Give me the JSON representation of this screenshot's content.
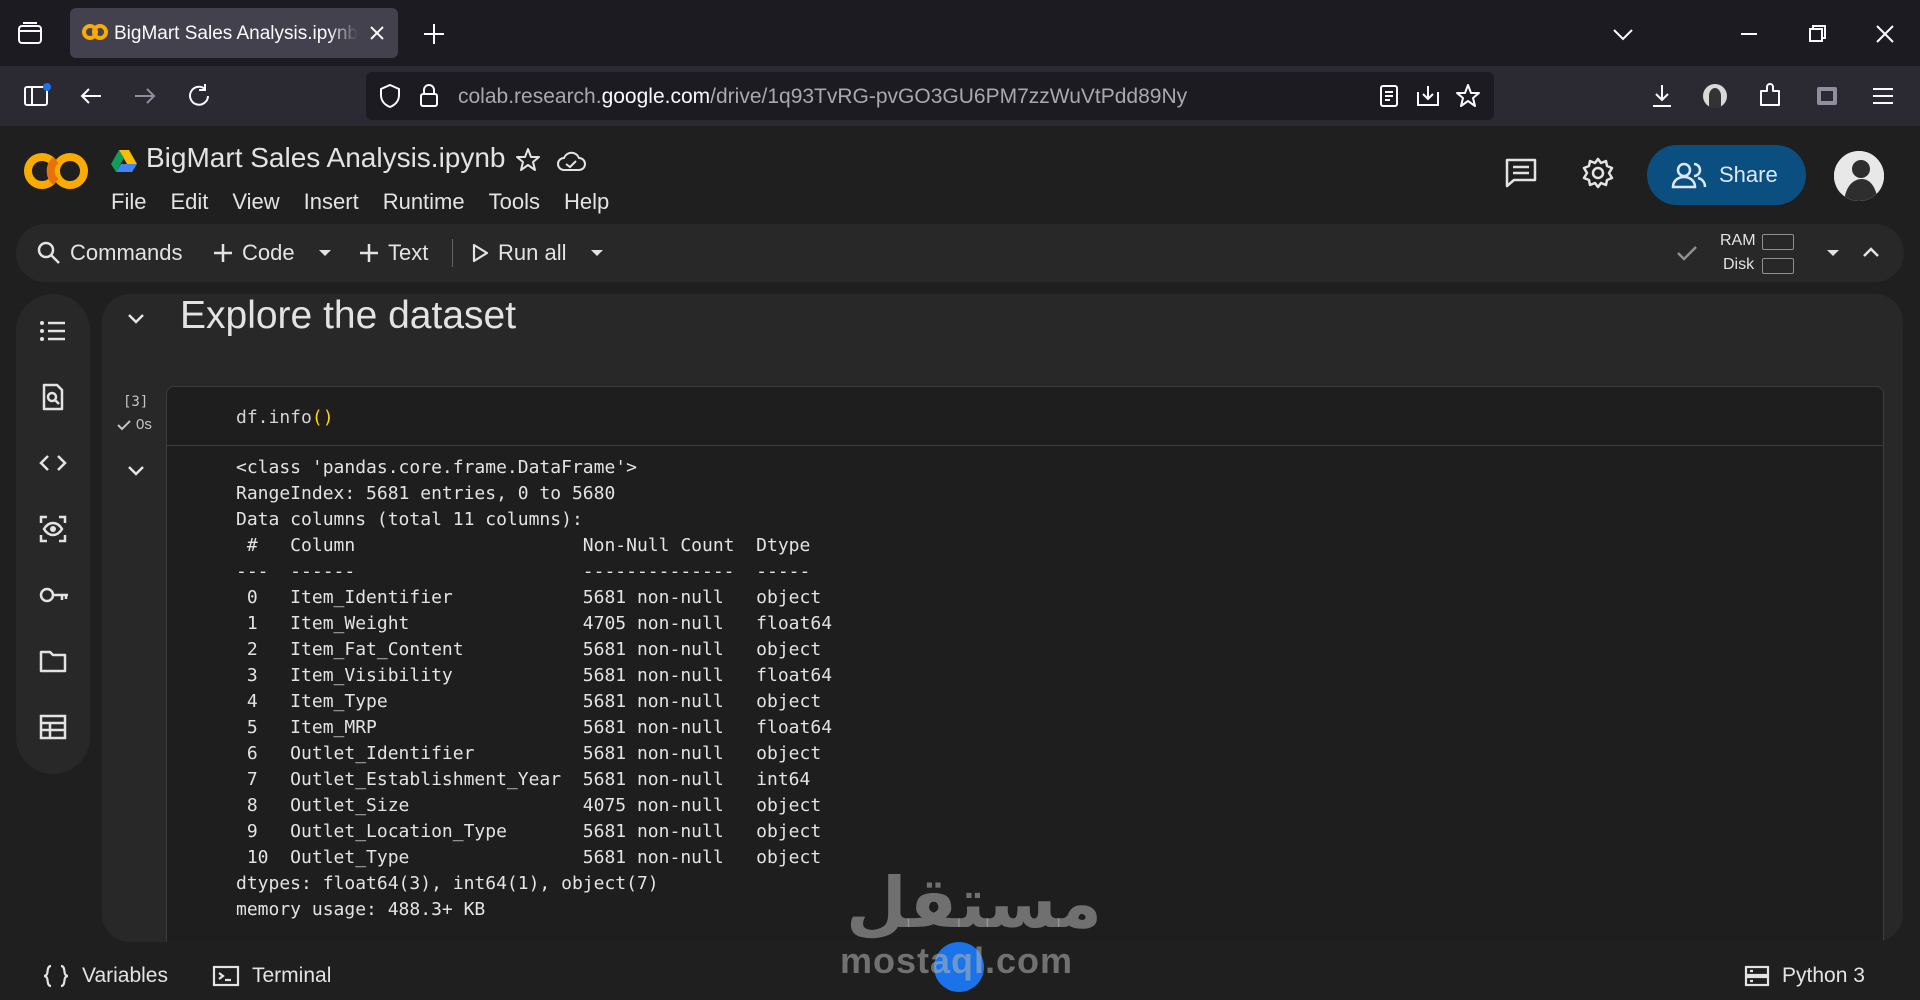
{
  "browser": {
    "tab_title": "BigMart Sales Analysis.ipynb - Colab",
    "url_prefix": "colab.research.",
    "url_host": "google.com",
    "url_path": "/drive/1q93TvRG-pvGO3GU6PM7zzWuVtPdd89Ny"
  },
  "header": {
    "notebook_title": "BigMart Sales Analysis.ipynb",
    "menu": [
      "File",
      "Edit",
      "View",
      "Insert",
      "Runtime",
      "Tools",
      "Help"
    ],
    "share_label": "Share"
  },
  "toolbar": {
    "commands_label": "Commands",
    "code_label": "Code",
    "text_label": "Text",
    "run_all_label": "Run all",
    "ram_label": "RAM",
    "disk_label": "Disk"
  },
  "notebook": {
    "section_title": "Explore the dataset",
    "cell": {
      "exec_count": "[3]",
      "exec_time": "0s",
      "code_prefix": "df.info",
      "code_parens": "()",
      "output": "<class 'pandas.core.frame.DataFrame'>\nRangeIndex: 5681 entries, 0 to 5680\nData columns (total 11 columns):\n #   Column                     Non-Null Count  Dtype  \n---  ------                     --------------  -----  \n 0   Item_Identifier            5681 non-null   object \n 1   Item_Weight                4705 non-null   float64\n 2   Item_Fat_Content           5681 non-null   object \n 3   Item_Visibility            5681 non-null   float64\n 4   Item_Type                  5681 non-null   object \n 5   Item_MRP                   5681 non-null   float64\n 6   Outlet_Identifier          5681 non-null   object \n 7   Outlet_Establishment_Year  5681 non-null   int64  \n 8   Outlet_Size                4075 non-null   object \n 9   Outlet_Location_Type       5681 non-null   object \n 10  Outlet_Type                5681 non-null   object \ndtypes: float64(3), int64(1), object(7)\nmemory usage: 488.3+ KB"
    }
  },
  "statusbar": {
    "variables_label": "Variables",
    "terminal_label": "Terminal",
    "kernel_label": "Python 3"
  },
  "watermark": {
    "arabic": "مستقل",
    "latin": "mostaql.com"
  },
  "colors": {
    "accent_share": "#0b4f80",
    "colab_orange": "#f9ab00",
    "background": "#1f1f1f",
    "surface": "#282828"
  }
}
